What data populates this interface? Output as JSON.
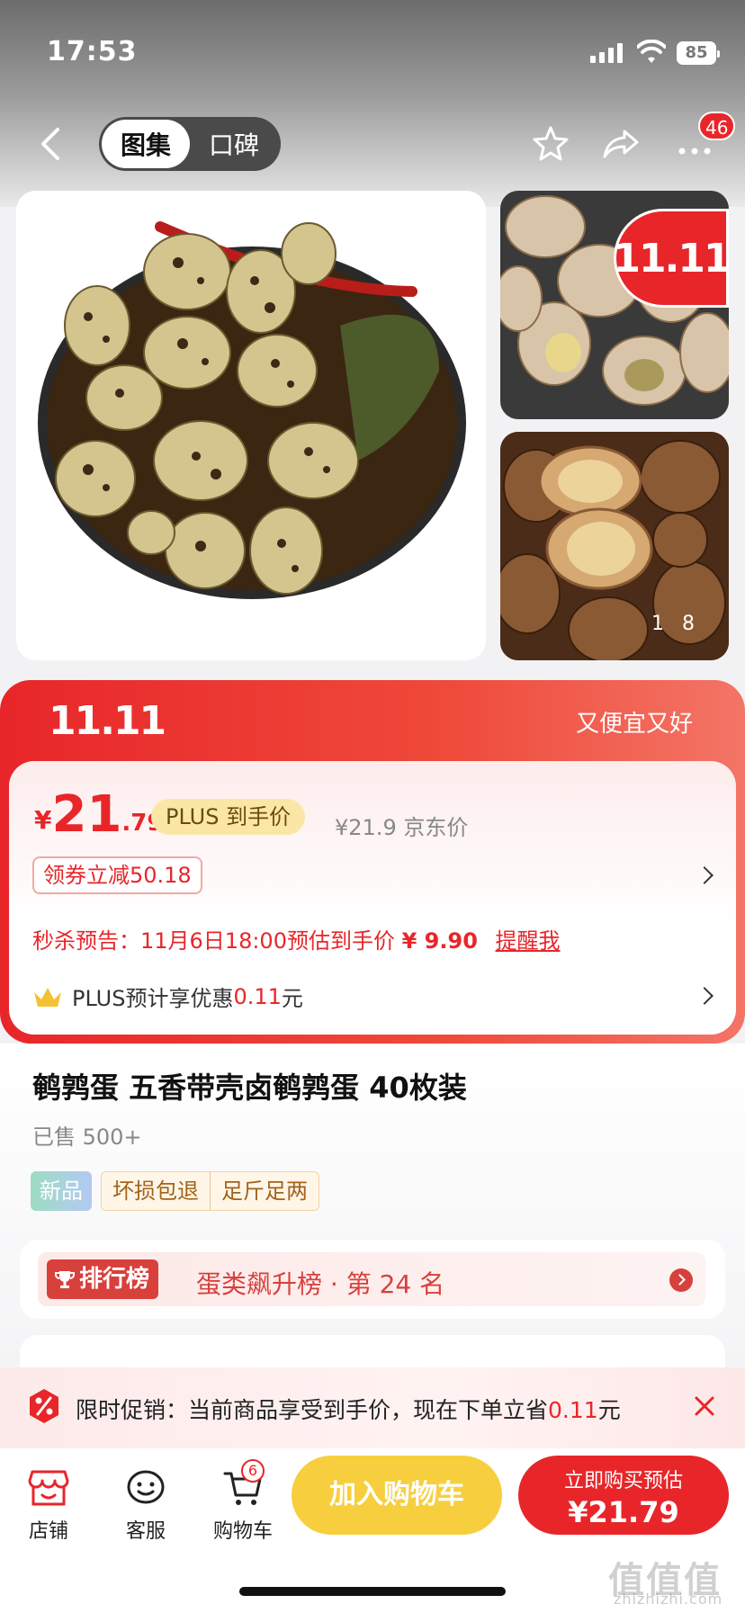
{
  "status_bar": {
    "time": "17:53",
    "battery": "85"
  },
  "nav": {
    "tab_active": "图集",
    "tab_inactive": "口碑",
    "more_badge": "46"
  },
  "gallery": {
    "promo_logo": "11.11",
    "pager": "18"
  },
  "promo": {
    "logo": "11.11",
    "slogan": "又便宜又好"
  },
  "price": {
    "currency": "¥",
    "integer": "21",
    "decimal": ".79",
    "plus_tag": "PLUS 到手价",
    "jd_price": "¥21.9 京东价",
    "coupon": "领券立减50.18",
    "flash_label": "秒杀预告：11月6日18:00预估到手价",
    "flash_price": "¥ 9.90",
    "flash_link": "提醒我",
    "plus_benefit_prefix": "PLUS预计享优惠",
    "plus_benefit_value": "0.11",
    "plus_benefit_unit": "元"
  },
  "product": {
    "title": "鹌鹑蛋 五香带壳卤鹌鹑蛋 40枚装",
    "sold": "已售 500+",
    "tag_new": "新品",
    "service_tags": [
      "坏损包退",
      "足斤足两"
    ]
  },
  "ranking": {
    "tag": "排行榜",
    "text": "蛋类飙升榜 · 第 24 名"
  },
  "limited_promo": {
    "text_prefix": "限时促销：当前商品享受到手价，现在下单立省",
    "value": "0.11",
    "unit": "元"
  },
  "bottom_bar": {
    "store": "店铺",
    "service": "客服",
    "cart": "购物车",
    "cart_badge": "6",
    "add_to_cart": "加入购物车",
    "buy_line1": "立即购买预估",
    "buy_line2": "¥21.79"
  },
  "watermark": {
    "logo": "值值值",
    "url": "zhizhizhi.com"
  },
  "colors": {
    "accent": "#e8262a",
    "cart_button": "#f7cf3e"
  }
}
